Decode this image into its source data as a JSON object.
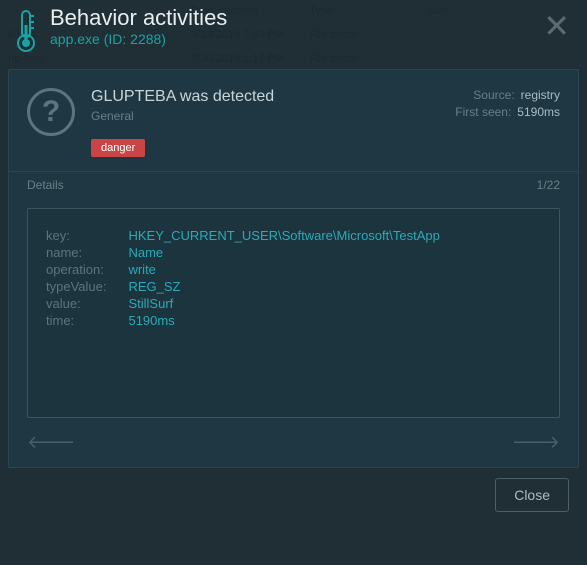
{
  "bg": {
    "headers": {
      "date": "Date modified",
      "type": "Type",
      "size": "Size"
    },
    "rows": [
      {
        "name": "8.tmp",
        "date": "3/23/2019 7:03 PM",
        "type": "File folder"
      },
      {
        "name": "np-files",
        "date": "7/30/2019 1:17 PM",
        "type": "File folder"
      }
    ]
  },
  "header": {
    "title": "Behavior activities",
    "subtitle": "app.exe  (ID: 2288)"
  },
  "panel": {
    "detection": "GLUPTEBA was detected",
    "general": "General",
    "badge": "danger",
    "source_label": "Source:",
    "source_value": "registry",
    "firstseen_label": "First seen:",
    "firstseen_value": "5190ms"
  },
  "details": {
    "title": "Details",
    "pager": "1/22",
    "rows": [
      {
        "k": "key:",
        "v": "HKEY_CURRENT_USER\\Software\\Microsoft\\TestApp"
      },
      {
        "k": "name:",
        "v": "Name"
      },
      {
        "k": "operation:",
        "v": "write"
      },
      {
        "k": "typeValue:",
        "v": "REG_SZ"
      },
      {
        "k": "value:",
        "v": "StillSurf"
      },
      {
        "k": "time:",
        "v": "5190ms"
      }
    ]
  },
  "footer": {
    "close": "Close"
  }
}
